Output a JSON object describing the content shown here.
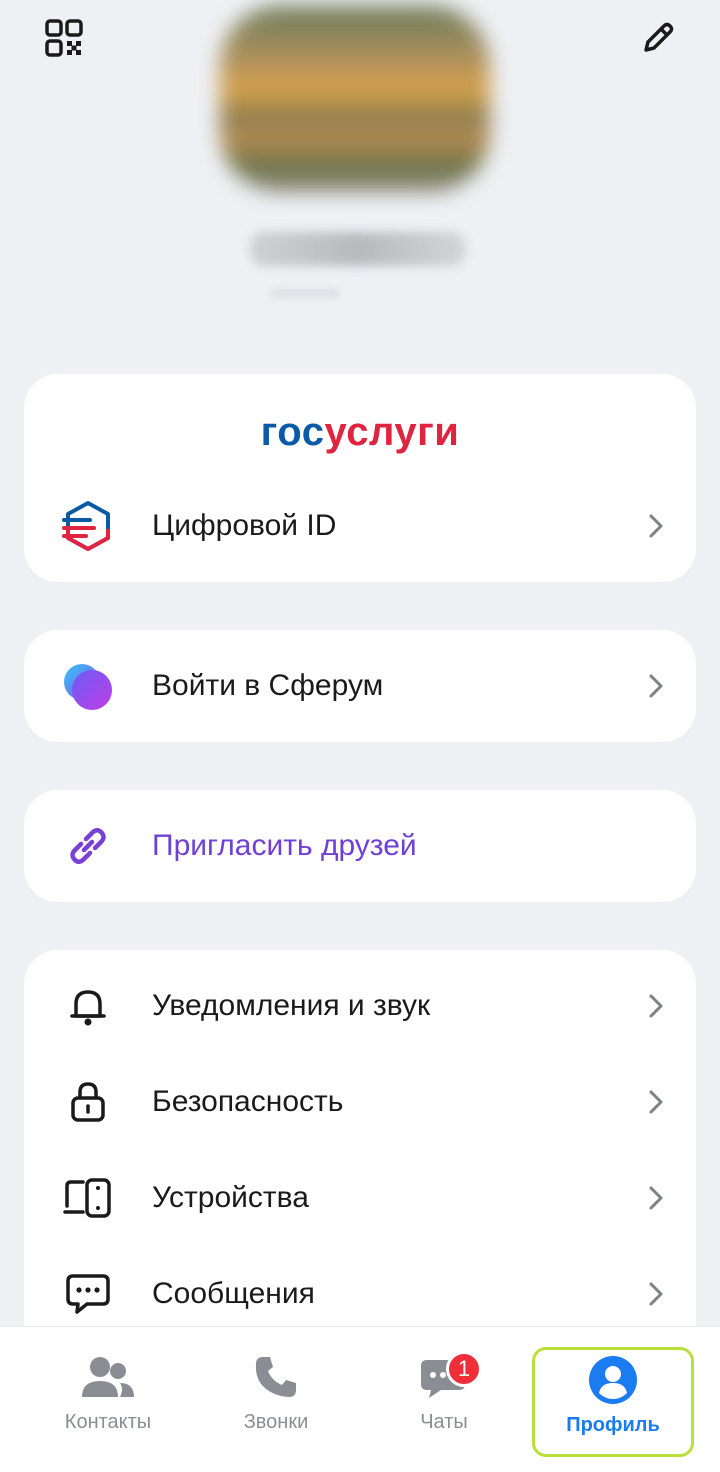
{
  "header": {
    "qr_icon": "qr-code-icon",
    "edit_icon": "pencil-icon",
    "name": "",
    "subtitle": ""
  },
  "gosuslugi": {
    "logo_part1": "гос",
    "logo_part2": "услуги",
    "item_label": "Цифровой ID"
  },
  "sferum": {
    "label": "Войти в Сферум"
  },
  "invite": {
    "label": "Пригласить друзей"
  },
  "settings": {
    "items": [
      {
        "label": "Уведомления и звук",
        "icon": "bell-icon"
      },
      {
        "label": "Безопасность",
        "icon": "lock-icon"
      },
      {
        "label": "Устройства",
        "icon": "devices-icon"
      },
      {
        "label": "Сообщения",
        "icon": "message-icon"
      }
    ]
  },
  "nav": {
    "contacts": "Контакты",
    "calls": "Звонки",
    "chats": "Чаты",
    "chats_badge": "1",
    "profile": "Профиль"
  },
  "colors": {
    "accent": "#1a7cf0",
    "invite": "#6f3fd6",
    "badge": "#ee2f3a",
    "highlight": "#b9e03a"
  }
}
